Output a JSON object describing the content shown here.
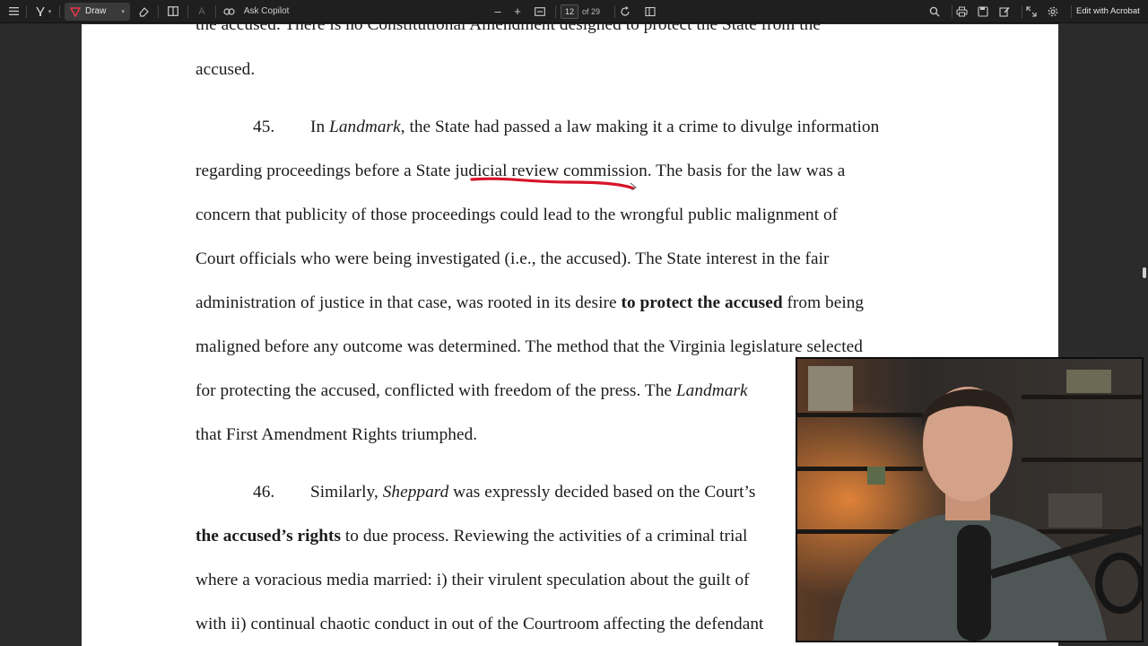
{
  "toolbar": {
    "draw_label": "Draw",
    "ask_copilot_label": "Ask Copilot",
    "page_current": "12",
    "page_total": "of 29",
    "edit_acrobat_label": "Edit with Acrobat",
    "icons": [
      "menu-icon",
      "highlighter-icon",
      "draw-pen-icon",
      "eraser-icon",
      "reading-view-icon",
      "text-size-icon",
      "copilot-icon",
      "zoom-out-icon",
      "zoom-in-icon",
      "fit-page-icon",
      "rotate-icon",
      "page-view-icon",
      "search-icon",
      "print-icon",
      "save-icon",
      "markup-icon",
      "expand-icon",
      "settings-icon"
    ]
  },
  "document": {
    "lines": [
      {
        "text": "the accused.  There is no Constitutional Amendment designed to protect the State from the"
      },
      {
        "text": "accused."
      },
      {
        "num": "45.",
        "parts": [
          "In ",
          "Landmark",
          ", the State had passed a law making it a crime to divulge information"
        ]
      },
      {
        "text": "regarding proceedings before a State judicial review commission.  The basis for the law was a"
      },
      {
        "text": "concern that publicity of those proceedings could lead to the wrongful public malignment of"
      },
      {
        "text": "Court officials who were being investigated (i.e., the accused).  The State interest in the fair"
      },
      {
        "parts": [
          "administration of justice in that case, was rooted in its desire ",
          "to protect the accused",
          " from being"
        ]
      },
      {
        "text": "maligned before any outcome was determined.  The method that the Virginia legislature selected"
      },
      {
        "parts": [
          "for protecting the accused, conflicted with freedom of the press.  The ",
          "Landmark"
        ]
      },
      {
        "text": "that First Amendment Rights triumphed."
      },
      {
        "num": "46.",
        "parts": [
          "Similarly, ",
          "Sheppard",
          " was expressly decided based on the Court’s"
        ]
      },
      {
        "parts": [
          "the accused’s rights",
          " to due process.  Reviewing the activities of a criminal trial"
        ]
      },
      {
        "text": "where a voracious media married: i) their virulent speculation about the guilt of"
      },
      {
        "text": "with ii) continual chaotic conduct in out of the Courtroom affecting the defendant"
      }
    ]
  },
  "annotation": {
    "ink_color": "#d7132a"
  },
  "webcam": {
    "present": true
  }
}
